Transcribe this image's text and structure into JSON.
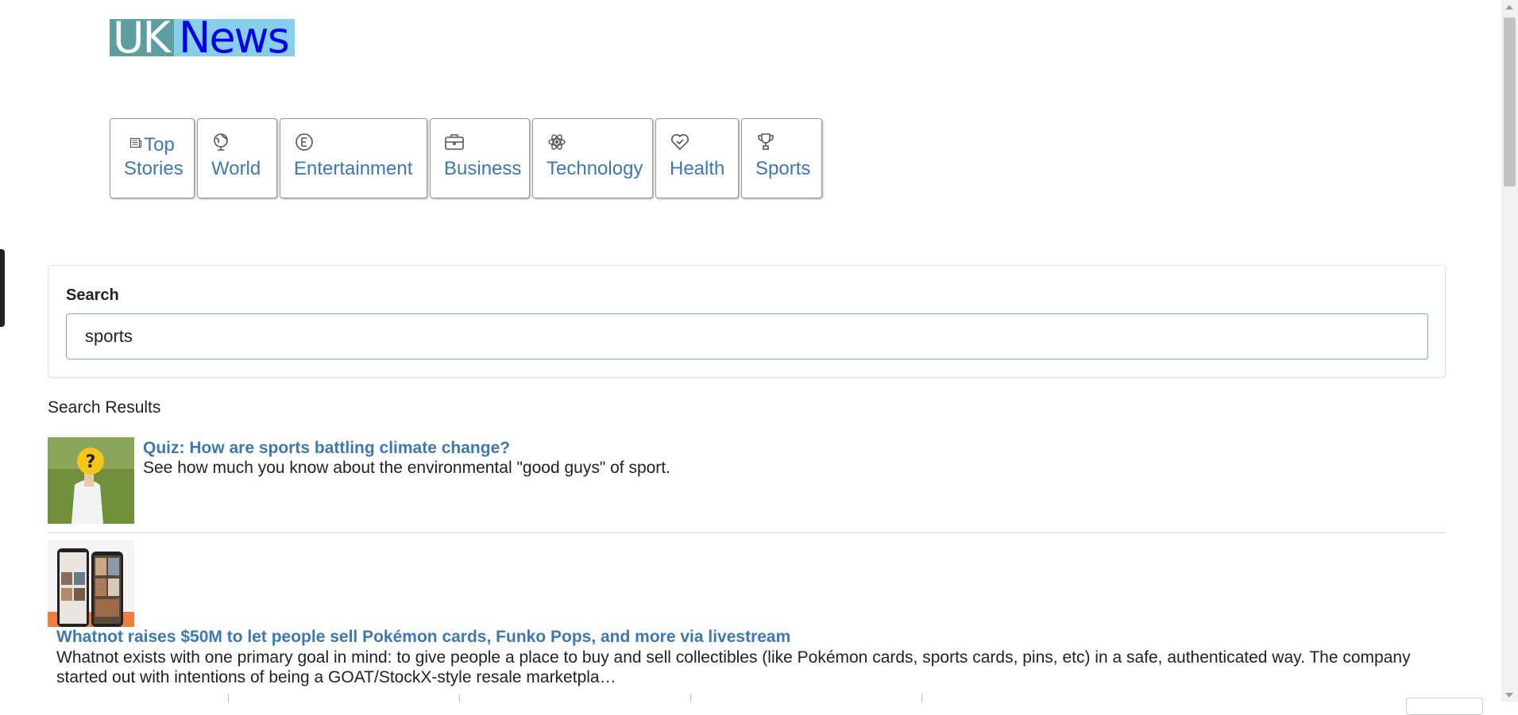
{
  "logo": {
    "part1": "UK",
    "part2": "News"
  },
  "nav": [
    {
      "label": "Top Stories",
      "icon": "newspaper-icon"
    },
    {
      "label": "World",
      "icon": "globe-icon"
    },
    {
      "label": "Entertainment",
      "icon": "entertainment-e-icon"
    },
    {
      "label": "Business",
      "icon": "briefcase-icon"
    },
    {
      "label": "Technology",
      "icon": "atom-icon"
    },
    {
      "label": "Health",
      "icon": "heart-check-icon"
    },
    {
      "label": "Sports",
      "icon": "trophy-icon"
    }
  ],
  "search": {
    "label": "Search",
    "value": "sports"
  },
  "results": {
    "title": "Search Results",
    "items": [
      {
        "title": "Quiz: How are sports battling climate change?",
        "description": "See how much you know about the environmental \"good guys\" of sport."
      },
      {
        "title": "Whatnot raises $50M to let people sell Pokémon cards, Funko Pops, and more via livestream",
        "description": "Whatnot exists with one primary goal in mind: to give people a place to buy and sell collectibles (like Pokémon cards, sports cards, pins, etc) in a safe, authenticated way. The company started out with intentions of being a GOAT/StockX-style resale marketpla…"
      }
    ]
  },
  "colors": {
    "link": "#3c78b4",
    "logo_uk_bg": "#5f9ea0",
    "logo_news_bg": "#87ceeb",
    "logo_news_text": "#0000ee"
  }
}
